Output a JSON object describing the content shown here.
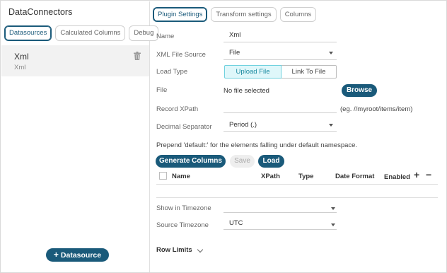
{
  "app": {
    "title": "DataConnectors"
  },
  "left_tabs": [
    {
      "label": "Datasources",
      "active": true
    },
    {
      "label": "Calculated Columns",
      "active": false
    },
    {
      "label": "Debug",
      "active": false
    }
  ],
  "datasource": {
    "name": "Xml",
    "type": "Xml",
    "delete_icon": "trash-icon"
  },
  "add_datasource": {
    "icon": "plus-icon",
    "label": "Datasource"
  },
  "settings_tabs": [
    {
      "label": "Plugin Settings",
      "active": true
    },
    {
      "label": "Transform settings",
      "active": false
    },
    {
      "label": "Columns",
      "active": false
    }
  ],
  "form": {
    "name": {
      "label": "Name",
      "value": "Xml"
    },
    "xml_file_source": {
      "label": "XML File Source",
      "value": "File"
    },
    "load_type": {
      "label": "Load Type",
      "options": [
        "Upload File",
        "Link To File"
      ],
      "selected": "Upload File"
    },
    "file": {
      "label": "File",
      "value": "No file selected",
      "browse_label": "Browse"
    },
    "record_xpath": {
      "label": "Record XPath",
      "value": "",
      "hint": "(eg. //myroot/items/item)"
    },
    "decimal_separator": {
      "label": "Decimal Separator",
      "value": "Period (.)"
    },
    "prepend_note": "Prepend 'default:' for the elements falling under default namespace."
  },
  "actions": {
    "generate": "Generate Columns",
    "save": "Save",
    "load": "Load"
  },
  "columns_table": {
    "headers": [
      "Name",
      "XPath",
      "Type",
      "Date Format",
      "Enabled"
    ],
    "add_icon": "+",
    "remove_icon": "−"
  },
  "timezone": {
    "show_label": "Show in Timezone",
    "show_value": "",
    "source_label": "Source Timezone",
    "source_value": "UTC"
  },
  "row_limits": {
    "label": "Row Limits"
  },
  "colors": {
    "accent": "#1a5a7a",
    "toggle_on_bg": "#dff7fa",
    "toggle_on_text": "#1a8aa0"
  }
}
